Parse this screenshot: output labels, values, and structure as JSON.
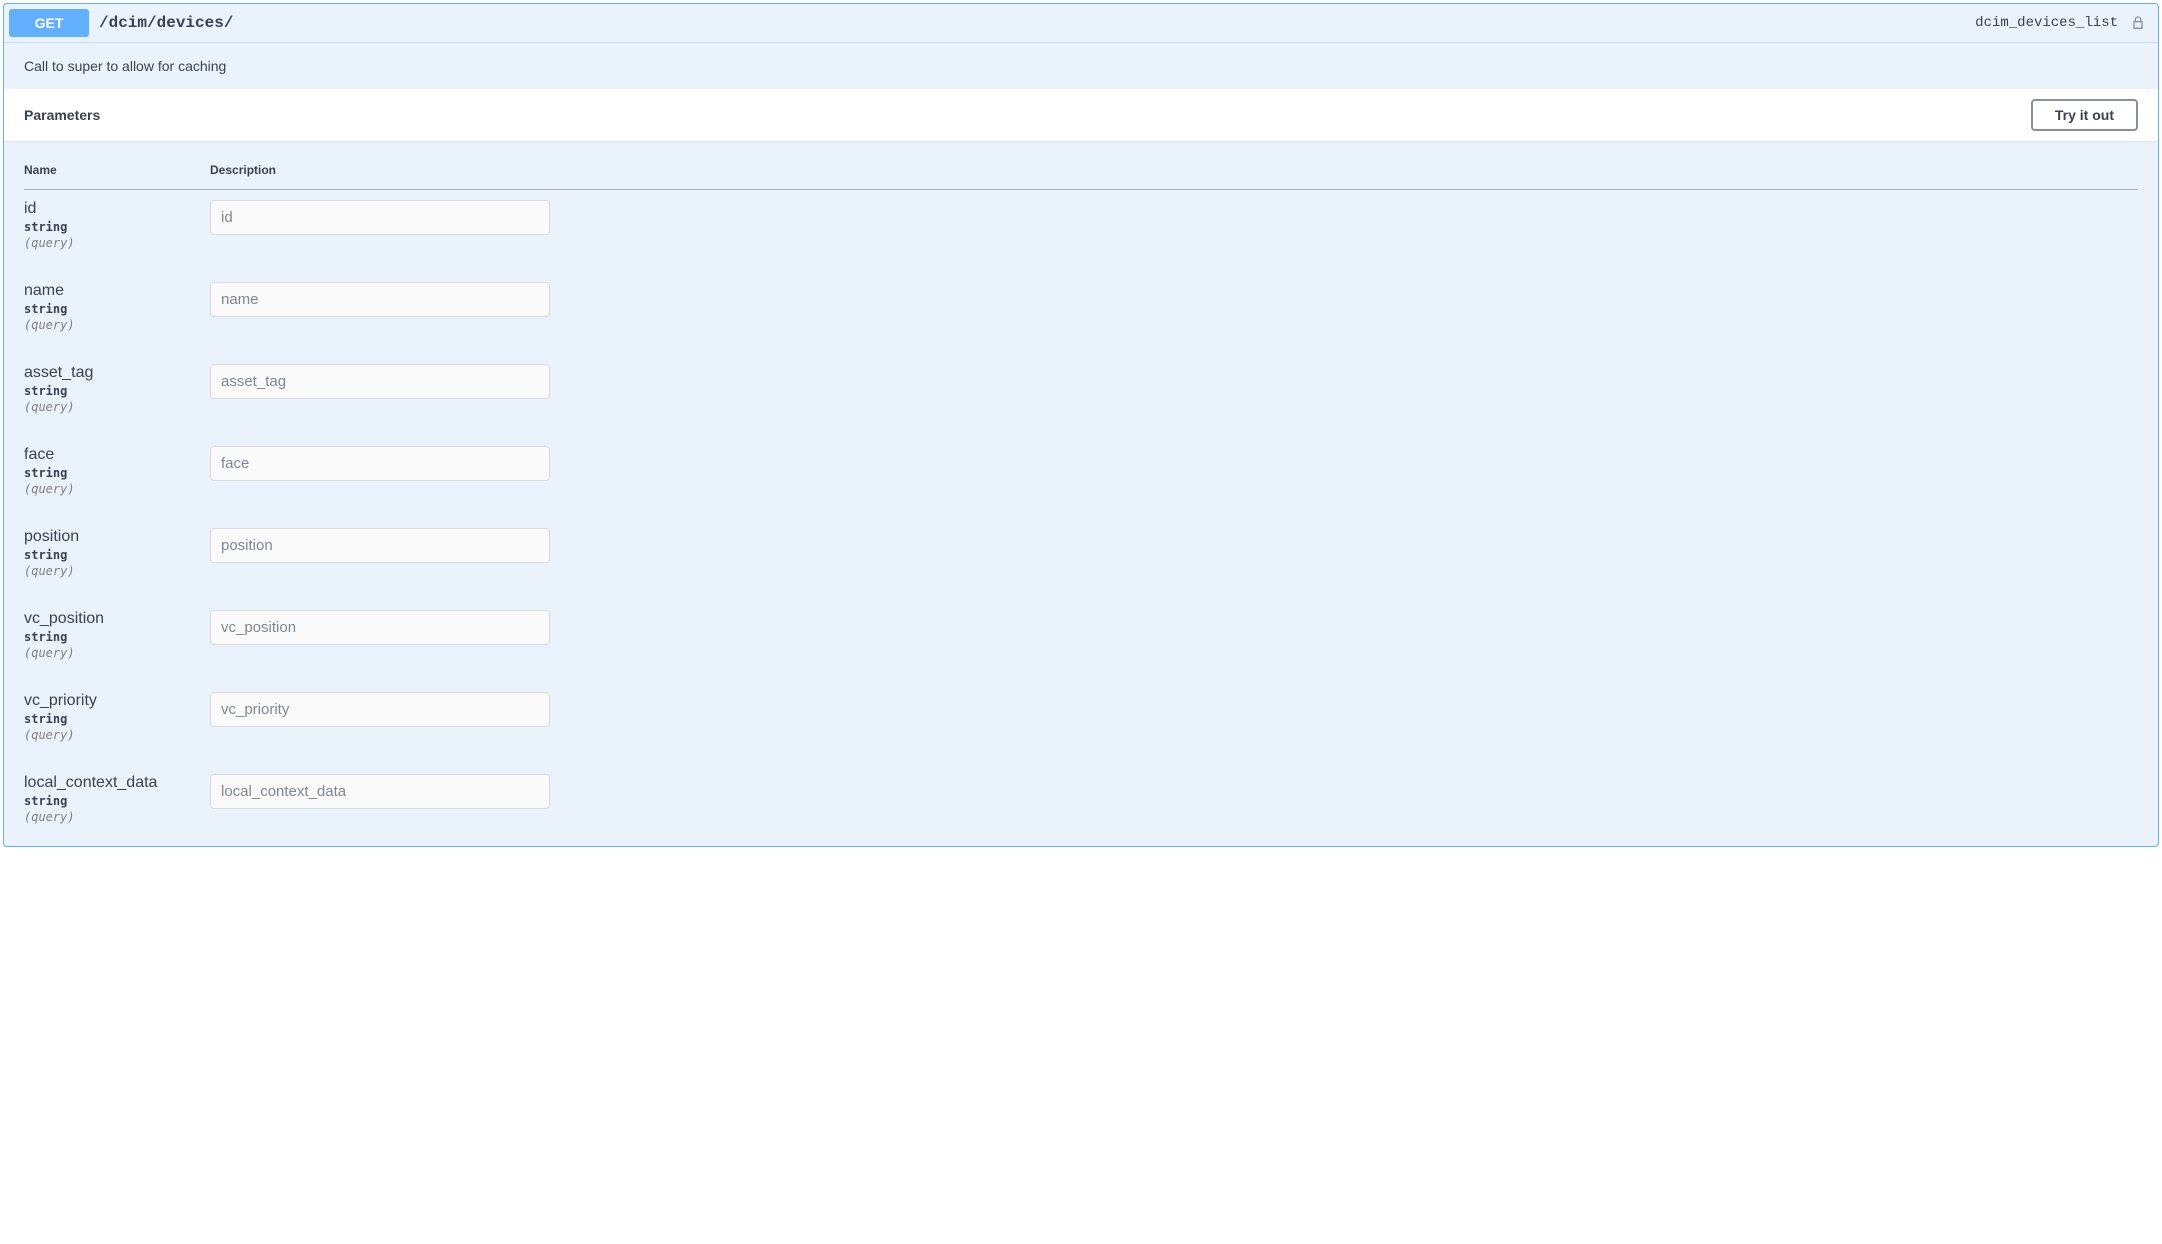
{
  "operation": {
    "method": "GET",
    "path": "/dcim/devices/",
    "id": "dcim_devices_list",
    "description": "Call to super to allow for caching"
  },
  "ui": {
    "parameters_title": "Parameters",
    "try_label": "Try it out",
    "col_name": "Name",
    "col_desc": "Description"
  },
  "parameters": [
    {
      "name": "id",
      "type": "string",
      "in": "(query)",
      "placeholder": "id"
    },
    {
      "name": "name",
      "type": "string",
      "in": "(query)",
      "placeholder": "name"
    },
    {
      "name": "asset_tag",
      "type": "string",
      "in": "(query)",
      "placeholder": "asset_tag"
    },
    {
      "name": "face",
      "type": "string",
      "in": "(query)",
      "placeholder": "face"
    },
    {
      "name": "position",
      "type": "string",
      "in": "(query)",
      "placeholder": "position"
    },
    {
      "name": "vc_position",
      "type": "string",
      "in": "(query)",
      "placeholder": "vc_position"
    },
    {
      "name": "vc_priority",
      "type": "string",
      "in": "(query)",
      "placeholder": "vc_priority"
    },
    {
      "name": "local_context_data",
      "type": "string",
      "in": "(query)",
      "placeholder": "local_context_data"
    }
  ]
}
